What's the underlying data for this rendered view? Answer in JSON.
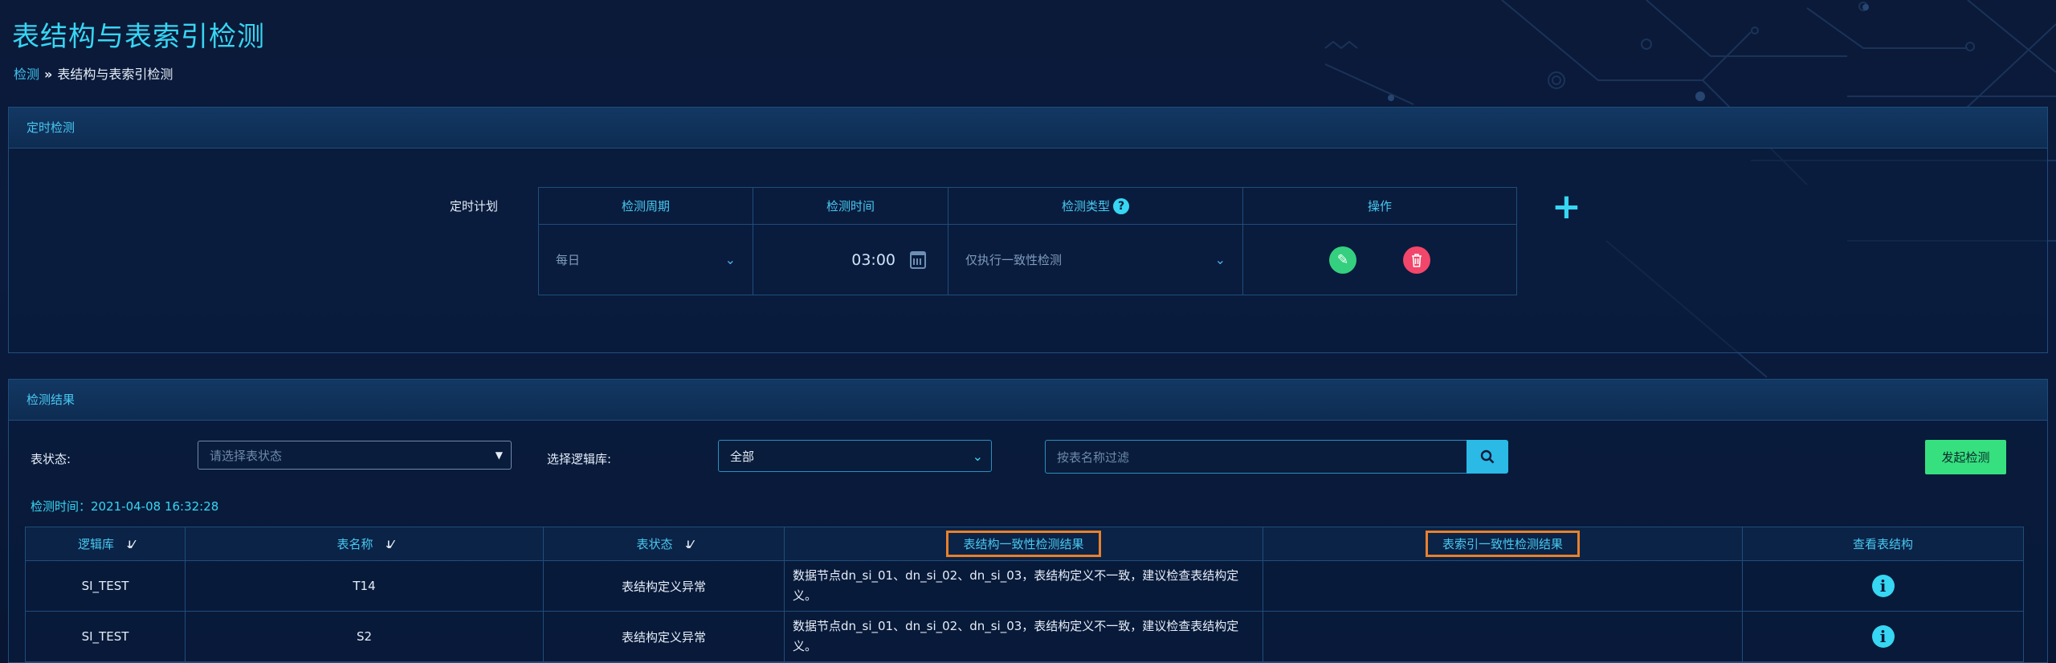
{
  "page": {
    "title": "表结构与表索引检测"
  },
  "breadcrumb": {
    "home": "检测",
    "separator": "»",
    "current": "表结构与表索引检测"
  },
  "schedule_panel": {
    "title": "定时检测",
    "label": "定时计划",
    "headers": {
      "period": "检测周期",
      "time": "检测时间",
      "type": "检测类型",
      "ops": "操作"
    },
    "row": {
      "period": "每日",
      "time": "03:00",
      "type": "仅执行一致性检测"
    }
  },
  "result_panel": {
    "title": "检测结果",
    "status_label": "表状态:",
    "status_placeholder": "请选择表状态",
    "db_label": "选择逻辑库:",
    "db_value": "全部",
    "search_placeholder": "按表名称过滤",
    "launch_button": "发起检测",
    "check_time": "检测时间：2021-04-08 16:32:28",
    "columns": [
      "逻辑库",
      "表名称",
      "表状态",
      "表结构一致性检测结果",
      "表索引一致性检测结果",
      "查看表结构"
    ],
    "rows": [
      {
        "db": "SI_TEST",
        "table": "T14",
        "status": "表结构定义异常",
        "structure": "数据节点dn_si_01、dn_si_02、dn_si_03，表结构定义不一致，建议检查表结构定义。",
        "index": ""
      },
      {
        "db": "SI_TEST",
        "table": "S2",
        "status": "表结构定义异常",
        "structure": "数据节点dn_si_01、dn_si_02、dn_si_03，表结构定义不一致，建议检查表结构定义。",
        "index": ""
      }
    ]
  },
  "icons": {
    "help": "question-circle-icon",
    "plus": "plus-icon",
    "edit": "pencil-icon",
    "delete": "trash-icon",
    "calendar": "calendar-icon",
    "search": "search-icon",
    "sort": "sort-icon",
    "info": "info-circle-icon"
  },
  "colors": {
    "accent": "#37d6f3",
    "success": "#36e07f",
    "danger": "#f2466a",
    "highlight": "#e8812c"
  }
}
